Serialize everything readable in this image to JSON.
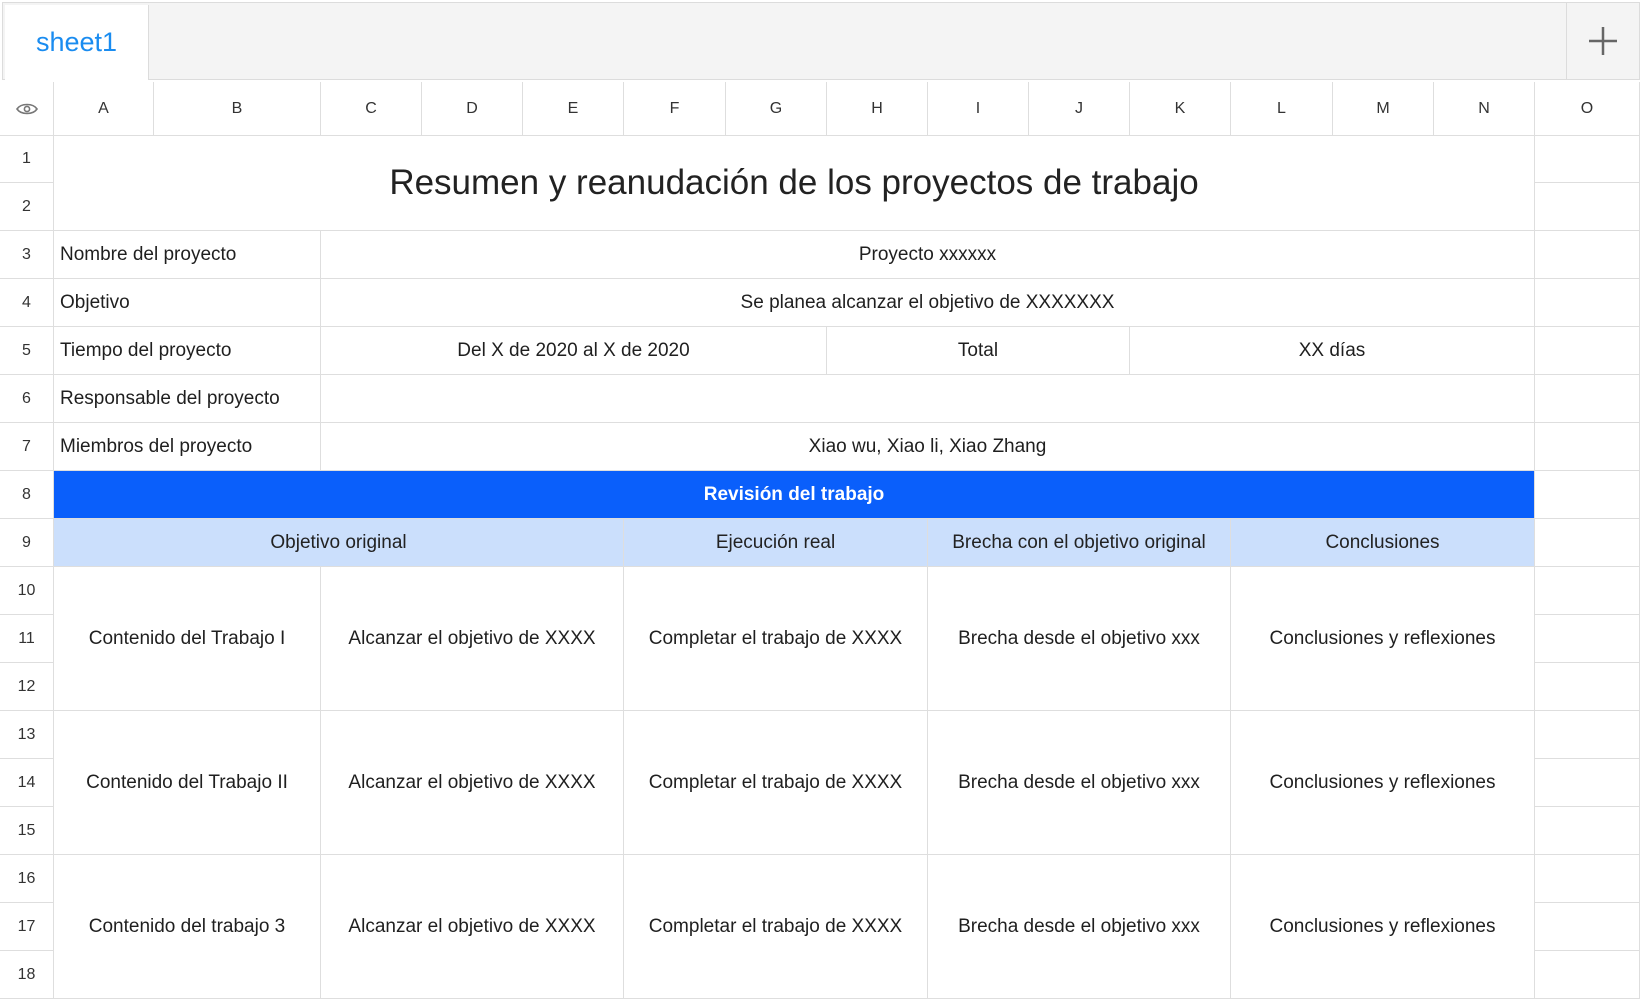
{
  "sheet_tab": {
    "name": "sheet1"
  },
  "columns": [
    "A",
    "B",
    "C",
    "D",
    "E",
    "F",
    "G",
    "H",
    "I",
    "J",
    "K",
    "L",
    "M",
    "N",
    "O"
  ],
  "rows": [
    "1",
    "2",
    "3",
    "4",
    "5",
    "6",
    "7",
    "8",
    "9",
    "10",
    "11",
    "12",
    "13",
    "14",
    "15",
    "16",
    "17",
    "18"
  ],
  "title": "Resumen y reanudación de los proyectos de trabajo",
  "info": {
    "name_label": "Nombre del proyecto",
    "name_value": "Proyecto xxxxxx",
    "objective_label": "Objetivo",
    "objective_value": "Se planea alcanzar el objetivo de XXXXXXX",
    "time_label": "Tiempo del proyecto",
    "time_value": "Del X de 2020 al X de 2020",
    "total_label": "Total",
    "total_value": "XX días",
    "owner_label": "Responsable del proyecto",
    "owner_value": "",
    "members_label": "Miembros del proyecto",
    "members_value": "Xiao wu, Xiao li, Xiao Zhang"
  },
  "review_header": "Revisión del trabajo",
  "table_headers": {
    "objective": "Objetivo original",
    "execution": "Ejecución real",
    "gap": "Brecha con el objetivo original",
    "conclusions": "Conclusiones"
  },
  "work_items": [
    {
      "content": "Contenido del Trabajo I",
      "objective": "Alcanzar el objetivo de XXXX",
      "execution": "Completar el trabajo de XXXX",
      "gap": "Brecha desde el objetivo xxx",
      "conclusions": "Conclusiones y reflexiones"
    },
    {
      "content": "Contenido del Trabajo II",
      "objective": "Alcanzar el objetivo de XXXX",
      "execution": "Completar el trabajo de XXXX",
      "gap": "Brecha desde el objetivo xxx",
      "conclusions": "Conclusiones y reflexiones"
    },
    {
      "content": "Contenido del trabajo 3",
      "objective": "Alcanzar el objetivo de XXXX",
      "execution": "Completar el trabajo de XXXX",
      "gap": "Brecha desde el objetivo xxx",
      "conclusions": "Conclusiones y reflexiones"
    }
  ],
  "icons": {
    "visibility": "eye-icon",
    "add_sheet": "plus-icon"
  },
  "colors": {
    "header_blue": "#0a5ffb",
    "subheader_blue": "#cbdffc",
    "tab_text": "#1a8cf0"
  }
}
